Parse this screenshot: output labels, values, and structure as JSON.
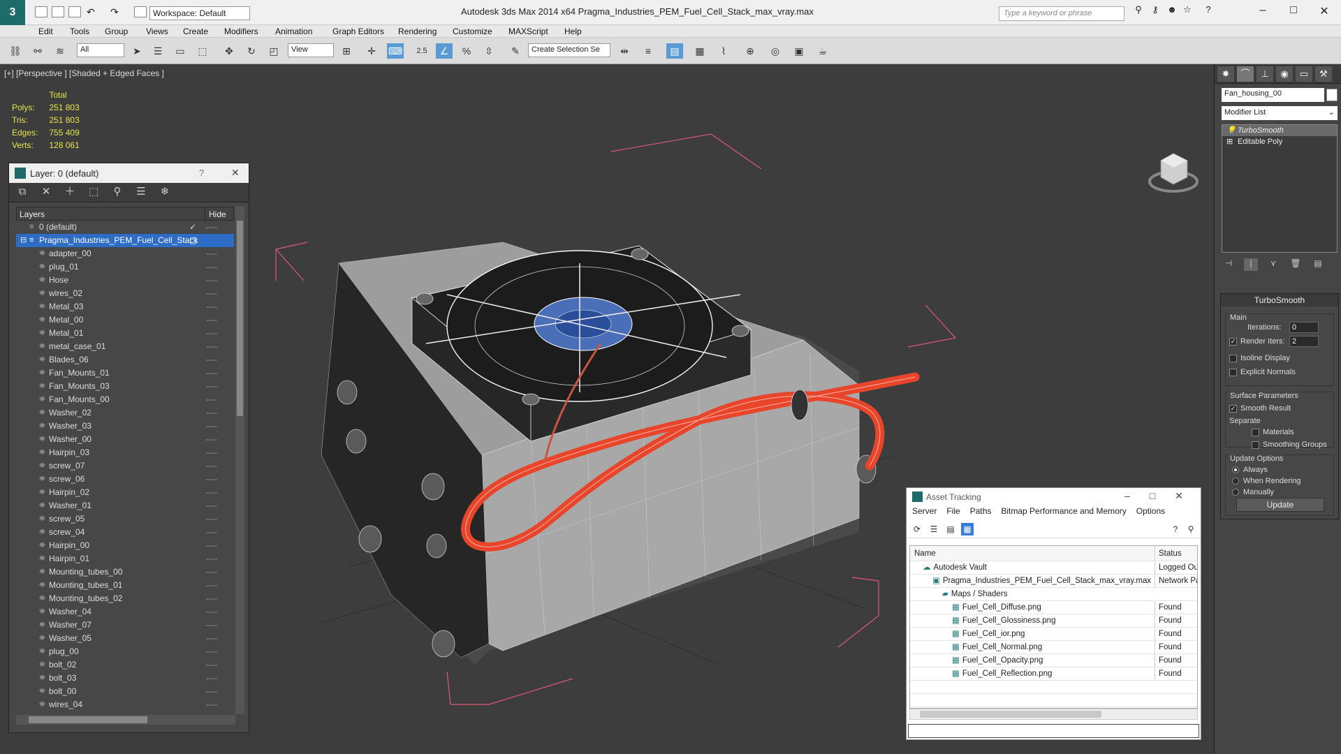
{
  "app": {
    "workspace": "Workspace: Default",
    "title": "Autodesk 3ds Max  2014 x64     Pragma_Industries_PEM_Fuel_Cell_Stack_max_vray.max",
    "search_placeholder": "Type a keyword or phrase"
  },
  "menu": [
    "Edit",
    "Tools",
    "Group",
    "Views",
    "Create",
    "Modifiers",
    "Animation",
    "Graph Editors",
    "Rendering",
    "Customize",
    "MAXScript",
    "Help"
  ],
  "toolbar": {
    "selection_filter": "All",
    "ref_coord": "View",
    "named_selection": "Create Selection Se",
    "snap_angle": "2.5"
  },
  "viewport": {
    "label": "[+] [Perspective ] [Shaded + Edged Faces ]",
    "stats_header": "Total",
    "stats": [
      {
        "label": "Polys:",
        "value": "251 803"
      },
      {
        "label": "Tris:",
        "value": "251 803"
      },
      {
        "label": "Edges:",
        "value": "755 409"
      },
      {
        "label": "Verts:",
        "value": "128 061"
      }
    ],
    "wire_color": "#e8452a"
  },
  "layer_panel": {
    "title": "Layer: 0 (default)",
    "col_layers": "Layers",
    "col_hide": "Hide",
    "top_items": [
      {
        "label": "0 (default)"
      },
      {
        "label": "Pragma_Industries_PEM_Fuel_Cell_Stack"
      }
    ],
    "items": [
      "adapter_00",
      "plug_01",
      "Hose",
      "wires_02",
      "Metal_03",
      "Metal_00",
      "Metal_01",
      "metal_case_01",
      "Blades_06",
      "Fan_Mounts_01",
      "Fan_Mounts_03",
      "Fan_Mounts_00",
      "Washer_02",
      "Washer_03",
      "Washer_00",
      "Hairpin_03",
      "screw_07",
      "screw_06",
      "Hairpin_02",
      "Washer_01",
      "screw_05",
      "screw_04",
      "Hairpin_00",
      "Hairpin_01",
      "Mounting_tubes_00",
      "Mounting_tubes_01",
      "Mounting_tubes_02",
      "Washer_04",
      "Washer_07",
      "Washer_05",
      "plug_00",
      "bolt_02",
      "bolt_03",
      "bolt_00",
      "wires_04"
    ]
  },
  "command_panel": {
    "object_name": "Fan_housing_00",
    "modifier_list": "Modifier List",
    "stack": [
      "TurboSmooth",
      "Editable Poly"
    ],
    "rollout_title": "TurboSmooth",
    "main_label": "Main",
    "iterations_label": "Iterations:",
    "iterations_value": "0",
    "render_iters_label": "Render Iters:",
    "render_iters_value": "2",
    "isoline": "Isoline Display",
    "explicit_normals": "Explicit Normals",
    "surface_params": "Surface Parameters",
    "smooth_result": "Smooth Result",
    "separate": "Separate",
    "materials": "Materials",
    "smoothing_groups": "Smoothing Groups",
    "update_options": "Update Options",
    "always": "Always",
    "when_rendering": "When Rendering",
    "manually": "Manually",
    "update_button": "Update"
  },
  "asset_tracking": {
    "title": "Asset Tracking",
    "menu": [
      "Server",
      "File",
      "Paths",
      "Bitmap Performance and Memory",
      "Options"
    ],
    "col_name": "Name",
    "col_status": "Status",
    "rows": [
      {
        "name": "Autodesk Vault",
        "status": "Logged Ou"
      },
      {
        "name": "Pragma_Industries_PEM_Fuel_Cell_Stack_max_vray.max",
        "status": "Network Pa"
      },
      {
        "name": "Maps / Shaders",
        "status": ""
      },
      {
        "name": "Fuel_Cell_Diffuse.png",
        "status": "Found"
      },
      {
        "name": "Fuel_Cell_Glossiness.png",
        "status": "Found"
      },
      {
        "name": "Fuel_Cell_ior.png",
        "status": "Found"
      },
      {
        "name": "Fuel_Cell_Normal.png",
        "status": "Found"
      },
      {
        "name": "Fuel_Cell_Opacity.png",
        "status": "Found"
      },
      {
        "name": "Fuel_Cell_Reflection.png",
        "status": "Found"
      }
    ]
  }
}
